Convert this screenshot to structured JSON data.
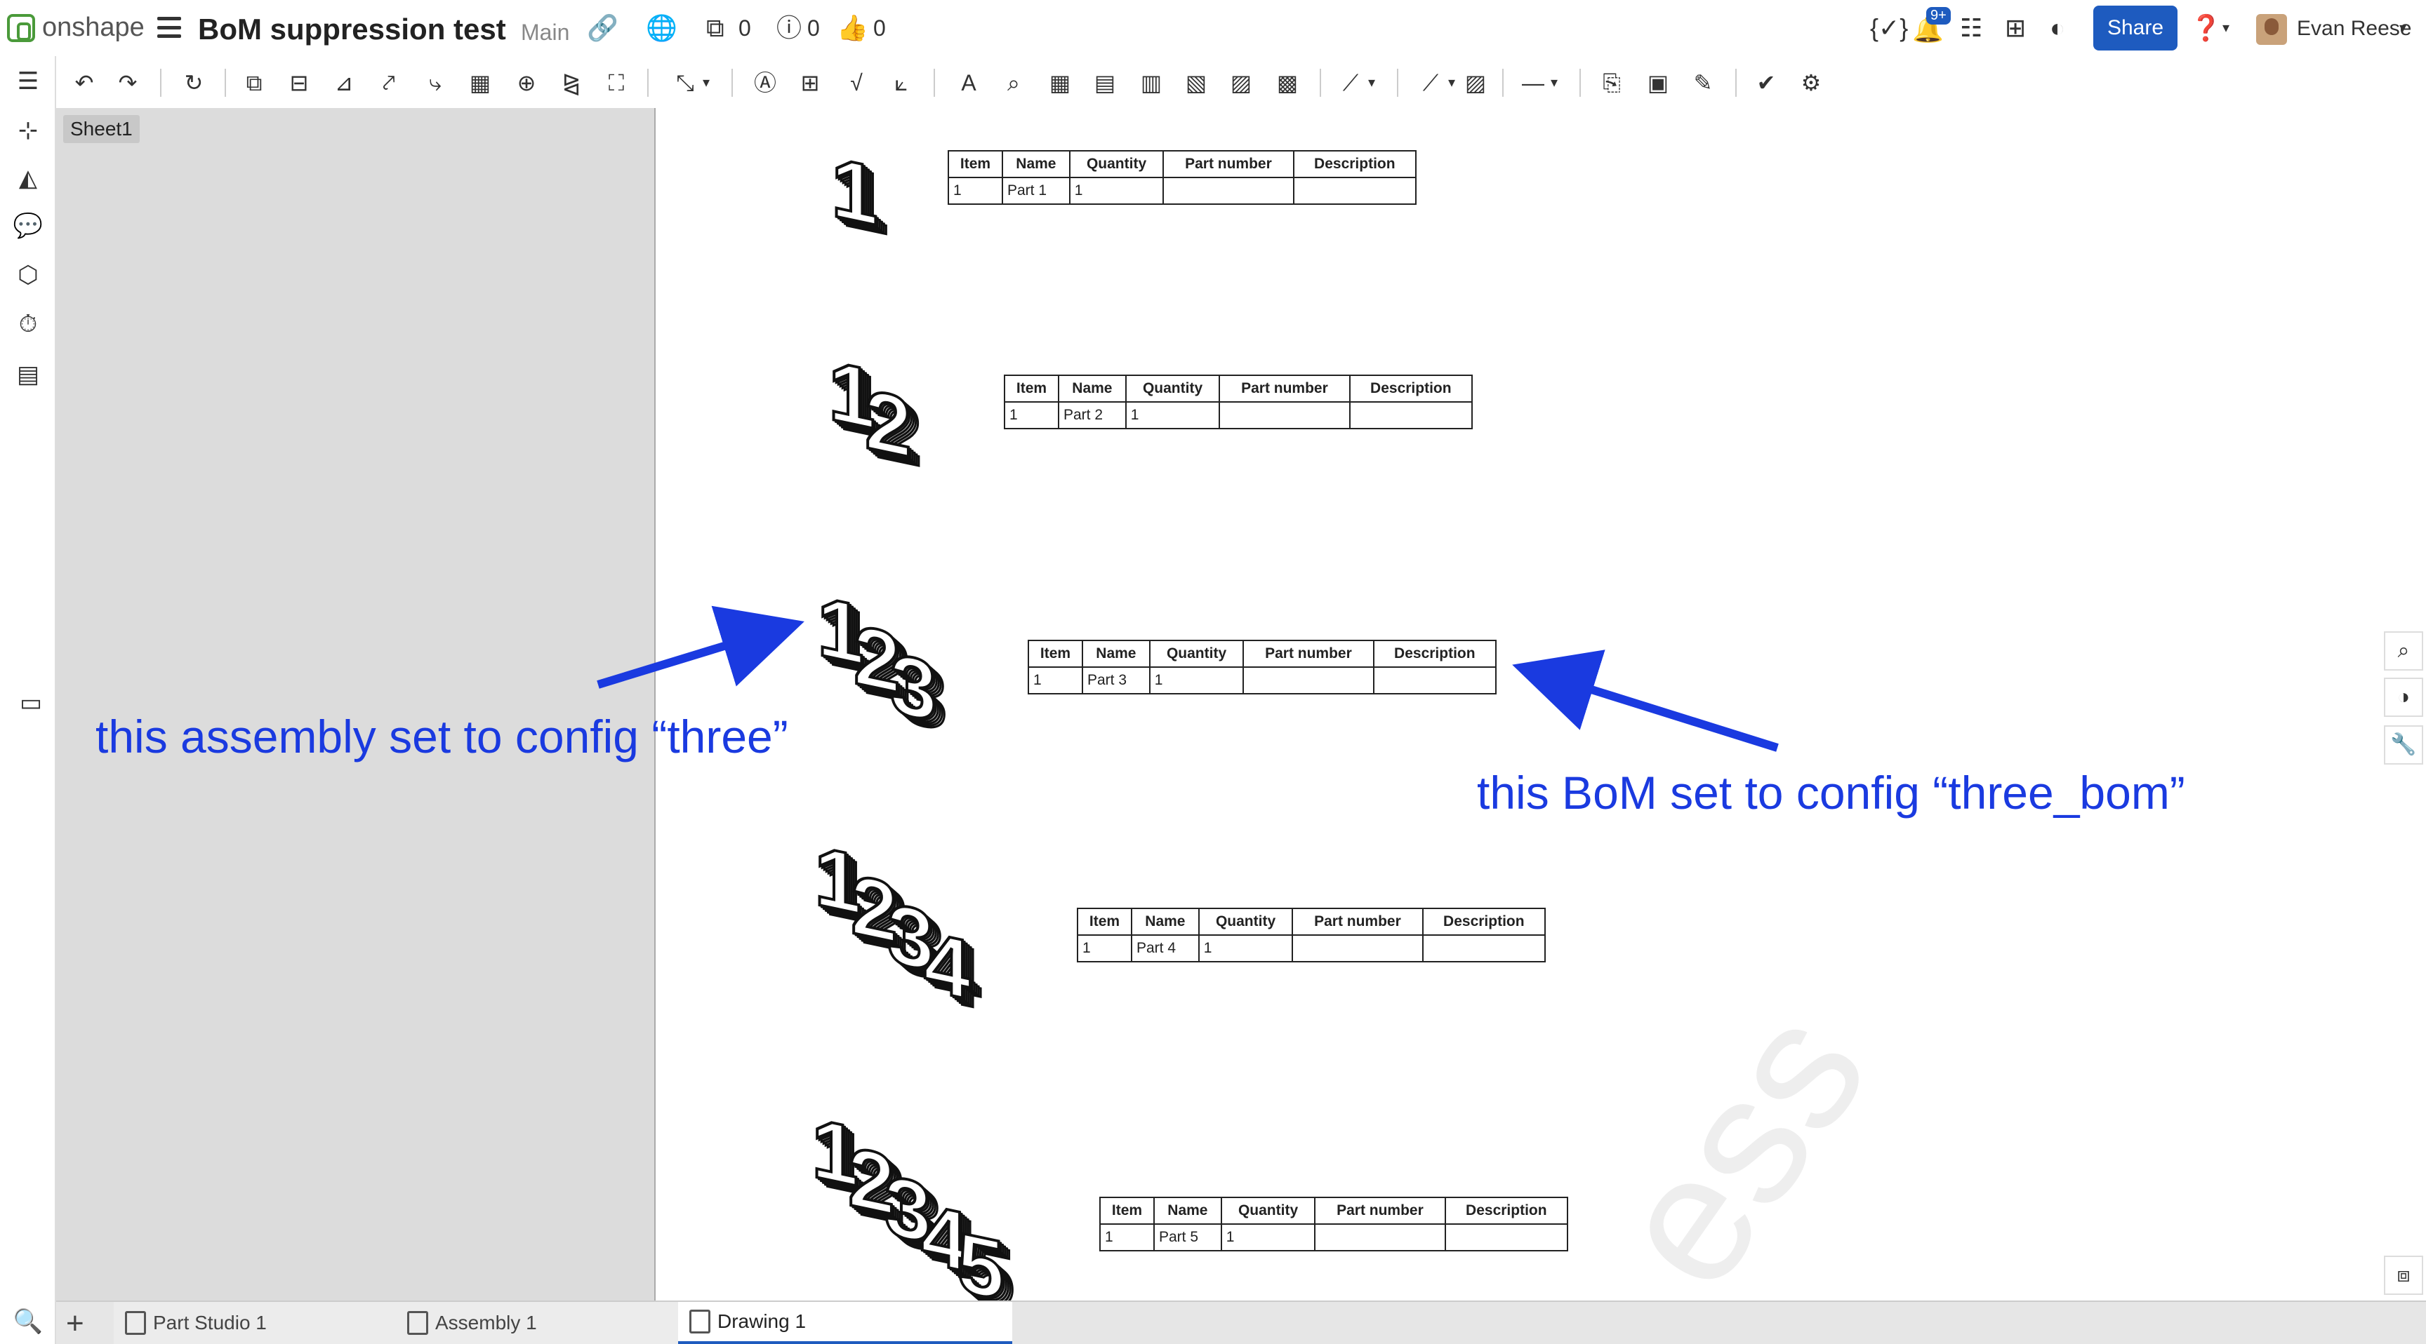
{
  "app": {
    "name": "onshape"
  },
  "document": {
    "title": "BoM suppression test",
    "branch": "Main"
  },
  "header": {
    "versions_count": "0",
    "info_count": "0",
    "likes_count": "0",
    "notifications_badge": "9+",
    "share_label": "Share",
    "user_name": "Evan Reese"
  },
  "sheets": [
    {
      "label": "Sheet1"
    }
  ],
  "boms": [
    {
      "headers": [
        "Item",
        "Name",
        "Quantity",
        "Part number",
        "Description"
      ],
      "row": [
        "1",
        "Part 1",
        "1",
        "",
        ""
      ]
    },
    {
      "headers": [
        "Item",
        "Name",
        "Quantity",
        "Part number",
        "Description"
      ],
      "row": [
        "1",
        "Part 2",
        "1",
        "",
        ""
      ]
    },
    {
      "headers": [
        "Item",
        "Name",
        "Quantity",
        "Part number",
        "Description"
      ],
      "row": [
        "1",
        "Part 3",
        "1",
        "",
        ""
      ]
    },
    {
      "headers": [
        "Item",
        "Name",
        "Quantity",
        "Part number",
        "Description"
      ],
      "row": [
        "1",
        "Part 4",
        "1",
        "",
        ""
      ]
    },
    {
      "headers": [
        "Item",
        "Name",
        "Quantity",
        "Part number",
        "Description"
      ],
      "row": [
        "1",
        "Part 5",
        "1",
        "",
        ""
      ]
    }
  ],
  "views": [
    {
      "digits": [
        "1"
      ]
    },
    {
      "digits": [
        "1",
        "2"
      ]
    },
    {
      "digits": [
        "1",
        "2",
        "3"
      ]
    },
    {
      "digits": [
        "1",
        "2",
        "3",
        "4"
      ]
    },
    {
      "digits": [
        "1",
        "2",
        "3",
        "4",
        "5"
      ]
    }
  ],
  "annotations": {
    "assembly_note": "this assembly set to config “three”",
    "bom_note": "this BoM set to config “three_bom”"
  },
  "tabs": [
    {
      "label": "Part Studio 1",
      "icon": "part-studio-icon"
    },
    {
      "label": "Assembly 1",
      "icon": "assembly-icon"
    },
    {
      "label": "Drawing 1",
      "icon": "drawing-icon",
      "active": true
    }
  ],
  "colors": {
    "accent": "#1e5bbf",
    "annotation": "#1a3ae0",
    "logo": "#4a9a3a"
  }
}
